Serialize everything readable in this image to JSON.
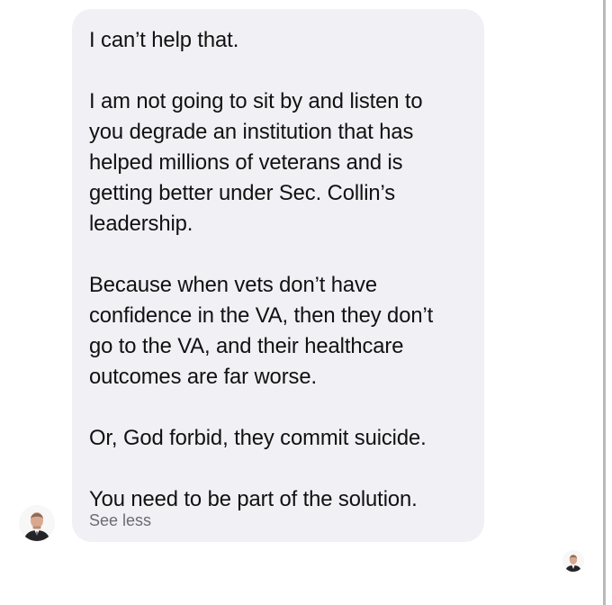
{
  "conversation": {
    "message": {
      "text": "I can’t help that.\n\nI am not going to sit by and listen to\nyou degrade an institution that has\nhelped millions of veterans and is\ngetting better under Sec. Collin’s\nleadership.\n\nBecause when vets don’t have\nconfidence in the VA, then they don’t\ngo to the VA, and their healthcare\noutcomes are far worse.\n\nOr, God forbid, they commit suicide.\n\nYou need to be part of the solution.",
      "see_less_label": "See less",
      "avatar_icon": "person-avatar-icon",
      "bubble_color": "#f0f0f5",
      "text_color": "#111111",
      "link_color": "#6b6b72"
    },
    "read_receipt": {
      "avatar_icon": "read-receipt-avatar-icon"
    }
  }
}
